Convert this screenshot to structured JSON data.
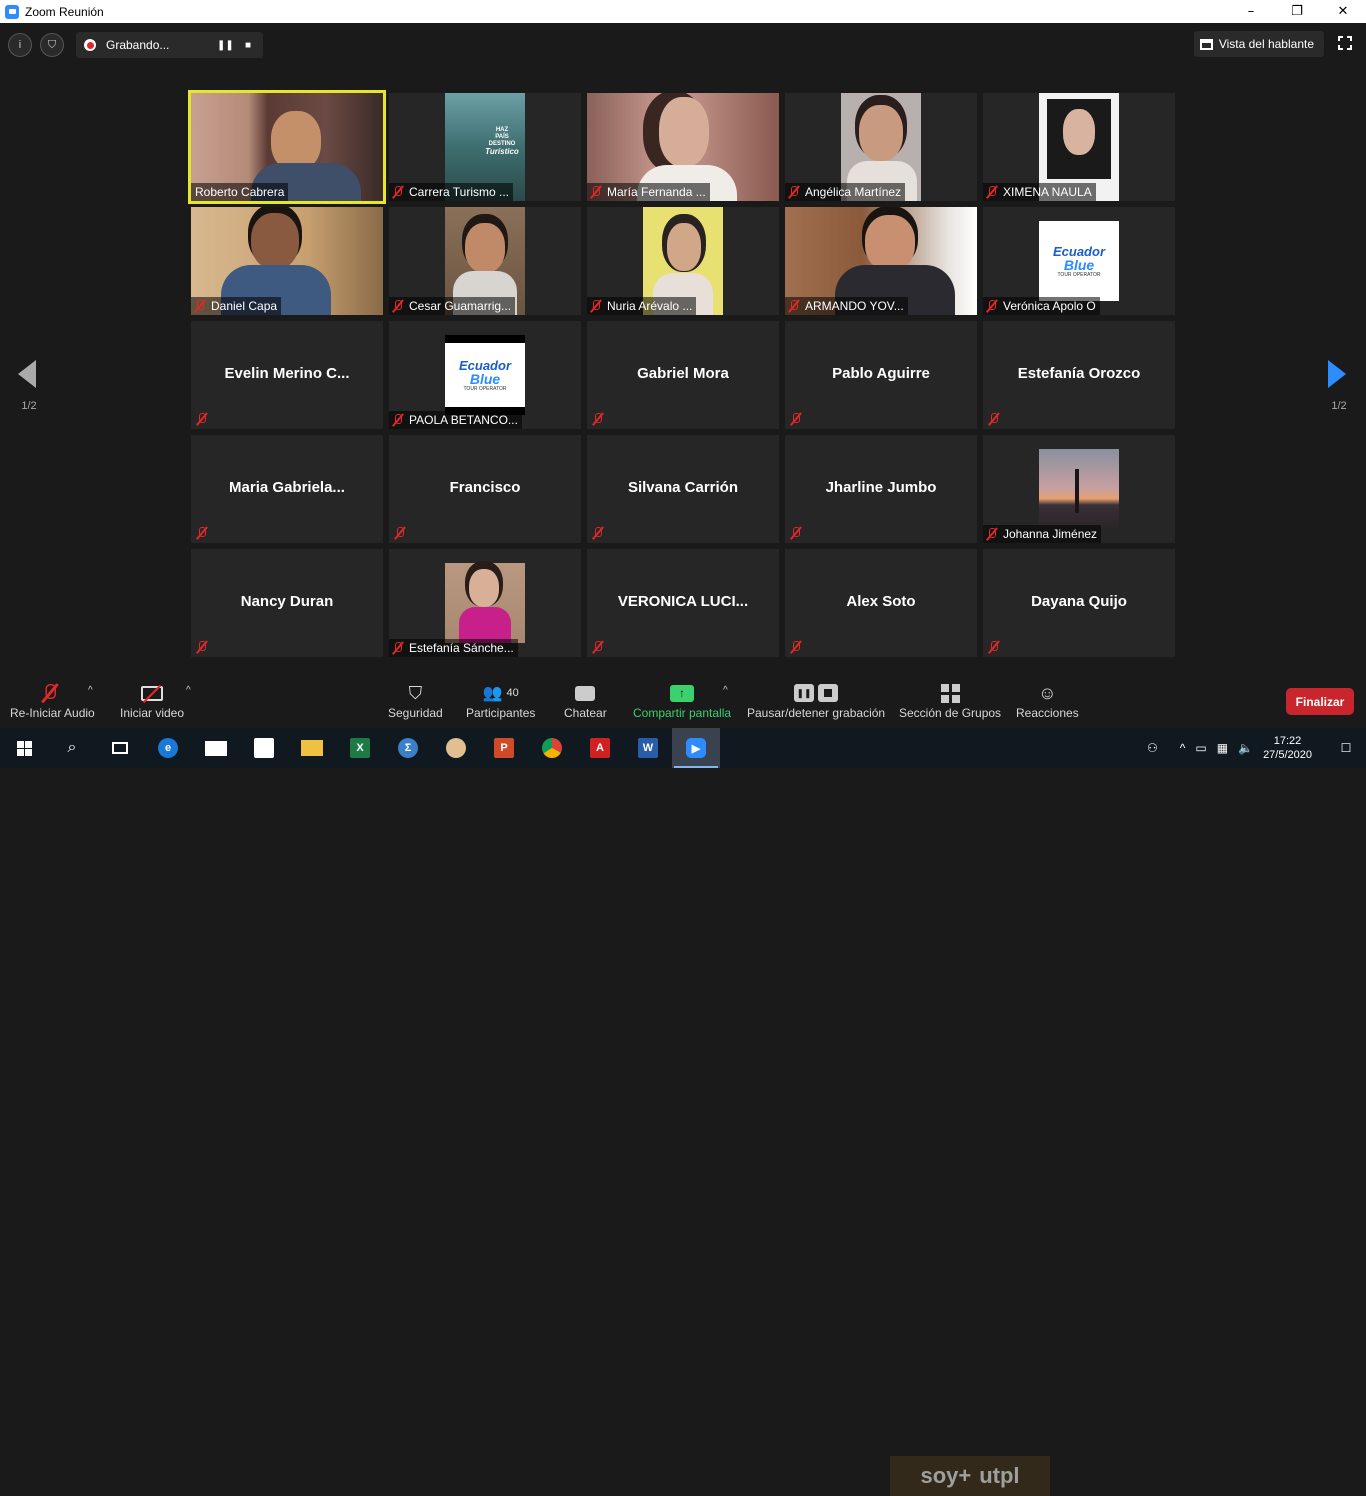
{
  "window": {
    "title": "Zoom Reunión",
    "controls": [
      "–",
      "❐",
      "✕"
    ]
  },
  "top": {
    "recording_label": "Grabando...",
    "speaker_view_label": "Vista del hablante"
  },
  "pager": {
    "left_page": "1/2",
    "right_page": "1/2"
  },
  "tiles": [
    {
      "name": "Roberto Cabrera",
      "kind": "video",
      "active": true,
      "muted": false
    },
    {
      "name": "Carrera Turismo ...",
      "kind": "image",
      "muted": true
    },
    {
      "name": "María Fernanda ...",
      "kind": "video",
      "muted": true
    },
    {
      "name": "Angélica Martínez",
      "kind": "video",
      "muted": true
    },
    {
      "name": "XIMENA NAULA",
      "kind": "video",
      "muted": true
    },
    {
      "name": "Daniel Capa",
      "kind": "video",
      "muted": true
    },
    {
      "name": "Cesar Guamarrig...",
      "kind": "video",
      "muted": true
    },
    {
      "name": "Nuria Arévalo ...",
      "kind": "video",
      "muted": true
    },
    {
      "name": "ARMANDO YOV...",
      "kind": "video",
      "muted": true
    },
    {
      "name": "Verónica Apolo O",
      "kind": "logo",
      "muted": true
    },
    {
      "name": "Evelin  Merino  C...",
      "kind": "name",
      "muted": true
    },
    {
      "name": "PAOLA BETANCO...",
      "kind": "logo",
      "muted": true
    },
    {
      "name": "Gabriel Mora",
      "kind": "name",
      "muted": true
    },
    {
      "name": "Pablo Aguirre",
      "kind": "name",
      "muted": true
    },
    {
      "name": "Estefanía Orozco",
      "kind": "name",
      "muted": true
    },
    {
      "name": "Maria  Gabriela...",
      "kind": "name",
      "muted": true
    },
    {
      "name": "Francisco",
      "kind": "name",
      "muted": true
    },
    {
      "name": "Silvana Carrión",
      "kind": "name",
      "muted": true
    },
    {
      "name": "Jharline Jumbo",
      "kind": "name",
      "muted": true
    },
    {
      "name": "Johanna Jiménez",
      "kind": "photo",
      "muted": true
    },
    {
      "name": "Nancy Duran",
      "kind": "name",
      "muted": true
    },
    {
      "name": "Estefanía Sánche...",
      "kind": "photo",
      "muted": true
    },
    {
      "name": "VERONICA  LUCI...",
      "kind": "name",
      "muted": true
    },
    {
      "name": "Alex Soto",
      "kind": "name",
      "muted": true
    },
    {
      "name": "Dayana Quijo",
      "kind": "name",
      "muted": true
    }
  ],
  "logos": {
    "utpl_text": [
      "HAZ",
      "PAÍS",
      "DESTINO",
      "Turístico"
    ],
    "ecuador_blue": [
      "Ecuador",
      "Blue",
      "TOUR OPERATOR"
    ]
  },
  "toolbar": {
    "audio_label": "Re-Iniciar Audio",
    "video_label": "Iniciar video",
    "security_label": "Seguridad",
    "participants_label": "Participantes",
    "participants_count": "40",
    "chat_label": "Chatear",
    "share_label": "Compartir pantalla",
    "recording_label": "Pausar/detener grabación",
    "breakout_label": "Sección de Grupos",
    "reactions_label": "Reacciones",
    "end_label": "Finalizar"
  },
  "taskbar": {
    "banner_text": [
      "soy+",
      "utpl"
    ],
    "time": "17:22",
    "date": "27/5/2020",
    "apps": [
      "windows",
      "search",
      "taskview",
      "edge",
      "mail",
      "store",
      "explorer",
      "excel",
      "mathtype",
      "paint",
      "powerpoint",
      "chrome",
      "acrobat",
      "word",
      "zoom"
    ]
  },
  "colors": {
    "accent": "#2d8cff",
    "active_speaker": "#e6e62a",
    "end": "#c9252c",
    "share": "#3bd16f",
    "mute": "#e02828"
  }
}
